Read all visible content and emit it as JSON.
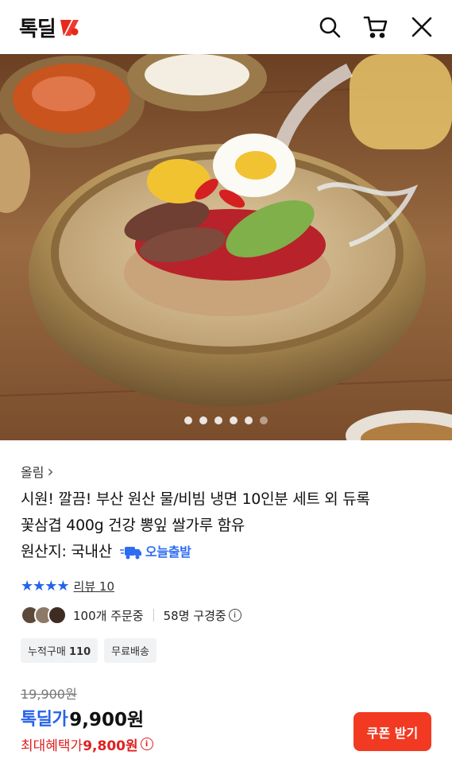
{
  "header": {
    "logo_text": "톡딜",
    "icons": [
      "search-icon",
      "cart-icon",
      "close-icon"
    ]
  },
  "gallery": {
    "image_subject": "bowl of cold noodles",
    "total_images": 6,
    "current_index": 6
  },
  "product": {
    "brand": "올림",
    "brand_chevron": "›",
    "title_line1": "시원! 깔끔! 부산 원산 물/비빔 냉면 10인분 세트 외 듀록",
    "title_line2": "꽃삼겹 400g 건강 뽕잎 쌀가루 함유",
    "origin": "원산지: 국내산",
    "shipping_badge": "오늘출발",
    "rating_stars": 4,
    "review_text": "리뷰 10",
    "orders_text": "100개 주문중",
    "browsing_text": "58명 구경중",
    "chips": [
      {
        "label": "누적구매",
        "value": "110"
      },
      {
        "label": "무료배송",
        "value": ""
      }
    ],
    "original_price": "19,900원",
    "deal_label": "톡딜가",
    "deal_price": "9,900원",
    "max_benefit_label": "최대혜택가",
    "max_benefit_price": "9,800원",
    "coupon_button": "쿠폰 받기"
  },
  "colors": {
    "accent_blue": "#2563eb",
    "deal_red": "#f23a22",
    "benefit_red": "#e02020",
    "logo_red": "#e8281c"
  }
}
